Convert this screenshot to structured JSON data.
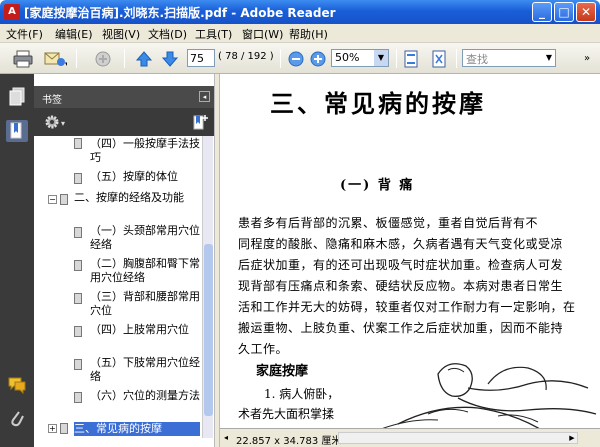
{
  "window": {
    "title": "[家庭按摩治百病].刘晓东.扫描版.pdf - Adobe Reader",
    "minimize": "_",
    "maximize": "□",
    "close": "✕"
  },
  "menu": [
    "文件(F)",
    "编辑(E)",
    "视图(V)",
    "文档(D)",
    "工具(T)",
    "窗口(W)",
    "帮助(H)"
  ],
  "toolbar": {
    "page_number": "75",
    "page_count": "( 78 / 192 )",
    "zoom": "50%",
    "search_placeholder": "查找"
  },
  "bookmarks": {
    "title": "书签",
    "collapse": "◂",
    "items": [
      {
        "label": "（四）一般按摩手法技巧",
        "selected": false
      },
      {
        "label": "（五）按摩的体位",
        "selected": false
      },
      {
        "label": "二、按摩的经络及功能",
        "selected": false,
        "expander": "⊟"
      },
      {
        "label": "（一）头颈部常用穴位经络",
        "selected": false
      },
      {
        "label": "（二）胸腹部和臀下常用穴位经络",
        "selected": false
      },
      {
        "label": "（三）背部和腰部常用穴位",
        "selected": false
      },
      {
        "label": "（四）上肢常用穴位",
        "selected": false
      },
      {
        "label": "（五）下肢常用穴位经络",
        "selected": false
      },
      {
        "label": "（六）穴位的测量方法",
        "selected": false
      },
      {
        "label": "三、常见病的按摩",
        "selected": true,
        "expander": "⊞"
      }
    ]
  },
  "document": {
    "heading": "三、常见病的按摩",
    "subheading": "(一) 背      痛",
    "paragraph": [
      "    患者多有后背部的沉累、板僵感觉，重者自觉后背有不",
      "同程度的酸胀、隐痛和麻木感，久病者遇有天气变化或受凉",
      "后症状加重，有的还可出现吸气时症状加重。检查病人可发",
      "现背部有压痛点和条索、硬结状反应物。本病对患者日常生",
      "活和工作并无大的妨碍，较重者仅对工作耐力有一定影响，在",
      "搬运重物、上肢负重、伏案工作之后症状加重，因而不能持",
      "久工作。"
    ],
    "section": "家庭按摩",
    "step1": "1. 病人俯卧，",
    "step1b": "术者先大面积掌揉"
  },
  "status": {
    "page_size": "22.857 x 34.783 厘米",
    "arrow": "◂"
  }
}
